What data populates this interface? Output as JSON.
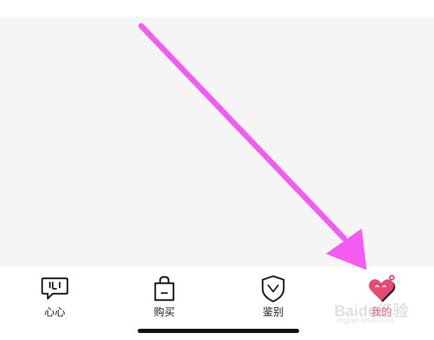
{
  "tabbar": {
    "tabs": [
      {
        "label": "心心",
        "icon": "chat-bubble-face-icon",
        "active": false
      },
      {
        "label": "购买",
        "icon": "shopping-bag-icon",
        "active": false
      },
      {
        "label": "鉴别",
        "icon": "shield-check-icon",
        "active": false
      },
      {
        "label": "我的",
        "icon": "heart-face-icon",
        "active": true
      }
    ]
  },
  "watermark": {
    "main": "Baidu经验",
    "sub": "jingyan.baidu.com"
  },
  "colors": {
    "content_background": "#f5f5f6",
    "active_tab": "#e84a74",
    "arrow": "#f45bf0",
    "text": "#1a1a1a"
  }
}
